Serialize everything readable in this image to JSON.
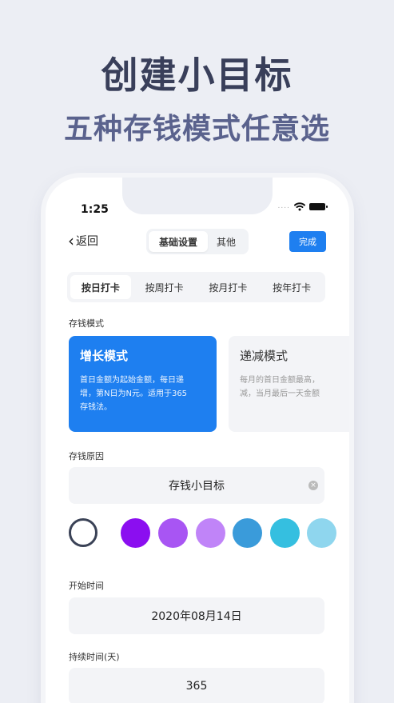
{
  "promo": {
    "title": "创建小目标",
    "subtitle": "五种存钱模式任意选"
  },
  "status_bar": {
    "time": "1:25",
    "signal": "....",
    "icons": [
      "wifi-icon",
      "battery-icon"
    ]
  },
  "nav": {
    "back_label": "返回",
    "tabs": [
      {
        "label": "基础设置",
        "selected": true
      },
      {
        "label": "其他",
        "selected": false
      }
    ],
    "done_label": "完成",
    "accent": "#1e7ff0"
  },
  "frequency": {
    "options": [
      "按日打卡",
      "按周打卡",
      "按月打卡",
      "按年打卡"
    ],
    "selected": "按日打卡"
  },
  "saving_mode": {
    "label": "存钱模式",
    "cards": [
      {
        "title": "增长模式",
        "desc_lines": [
          "首日金额为起始金额，每日递",
          "增，第N日为N元。适用于365",
          "存钱法。"
        ],
        "selected": true
      },
      {
        "title": "递减模式",
        "desc_lines": [
          "每月的首日金额最高，",
          "减，当月最后一天金额"
        ],
        "selected": false
      }
    ]
  },
  "reason": {
    "label": "存钱原因",
    "value": "存钱小目标"
  },
  "colors": {
    "selected_ring": "#3a4256",
    "swatches": [
      "#8b0ef0",
      "#a855f3",
      "#c084f8",
      "#3a9bda",
      "#35bfe0",
      "#8fd6ee"
    ]
  },
  "start_time": {
    "label": "开始时间",
    "value": "2020年08月14日"
  },
  "duration": {
    "label": "持续时间(天)",
    "value": "365"
  }
}
